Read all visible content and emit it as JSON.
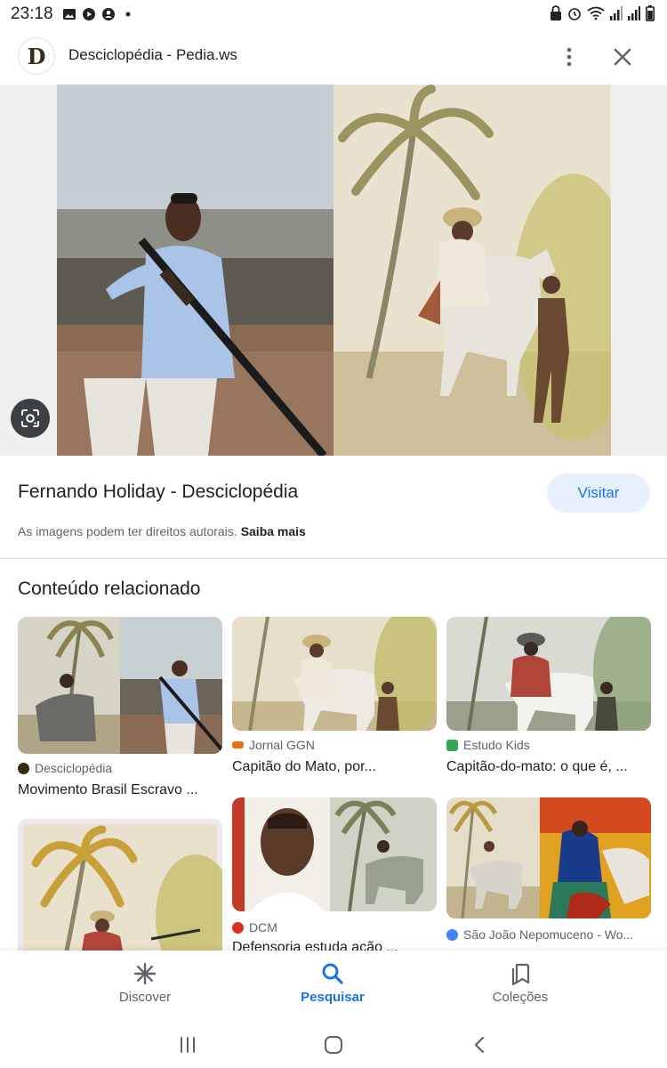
{
  "status_bar": {
    "time": "23:18",
    "left_icons": [
      "gallery-icon",
      "youtube-icon",
      "account-icon",
      "dot-icon"
    ],
    "right_icons": [
      "lock-icon",
      "alarm-icon",
      "wifi-icon",
      "signal-icon",
      "signal-icon",
      "battery-icon"
    ]
  },
  "header": {
    "logo_letter": "D",
    "title": "Desciclopédia - Pedia.ws"
  },
  "result": {
    "title": "Fernando Holiday - Desciclopédia",
    "visit_label": "Visitar",
    "copyright": "As imagens podem ter direitos autorais.",
    "learn_more": "Saiba mais"
  },
  "related": {
    "heading": "Conteúdo relacionado",
    "items": [
      {
        "source": "Desciclopédia",
        "caption": "Movimento Brasil Escravo ...",
        "source_color": "#3a2a10"
      },
      {
        "source": "Jornal GGN",
        "caption": "Capitão do Mato, por...",
        "source_color": "#e8710a"
      },
      {
        "source": "Estudo Kids",
        "caption": "Capitão-do-mato: o que é, ...",
        "source_color": "#34a853"
      },
      {
        "source": "DCM",
        "caption": "Defensoria estuda ação ...",
        "source_color": "#d93025"
      },
      {
        "source": "São João Nepomuceno - Wo...",
        "caption": "",
        "source_color": "#4285f4"
      }
    ]
  },
  "bottom_nav": {
    "items": [
      {
        "label": "Discover",
        "icon": "asterisk-icon"
      },
      {
        "label": "Pesquisar",
        "icon": "search-icon"
      },
      {
        "label": "Coleções",
        "icon": "bookmarks-icon"
      }
    ],
    "active": "Pesquisar"
  },
  "colors": {
    "accent": "#1a73e8",
    "visit_bg": "#e8f0fe",
    "text_primary": "#202124",
    "text_secondary": "#5f6368"
  }
}
